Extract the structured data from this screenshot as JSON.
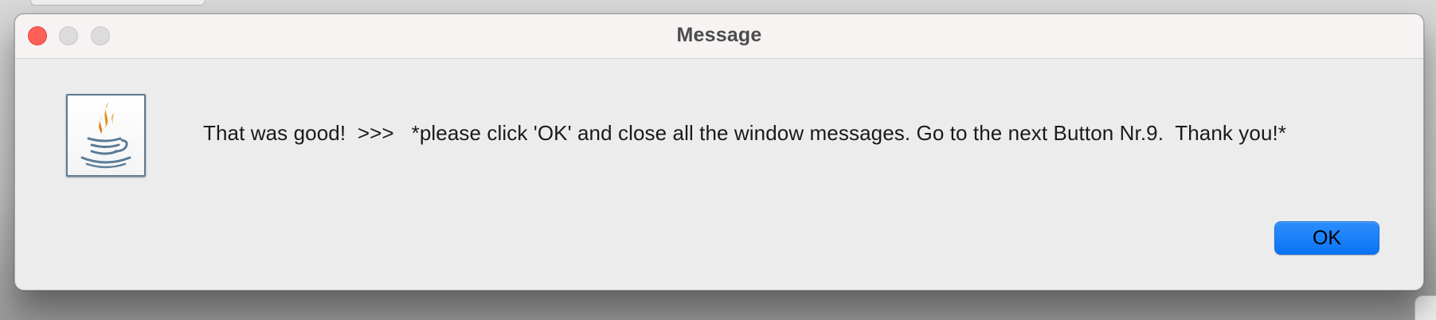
{
  "window": {
    "title": "Message"
  },
  "dialog": {
    "icon": "java-coffee-cup-icon",
    "message": "That was good!  >>>   *please click 'OK' and close all the window messages. Go to the next Button Nr.9.  Thank you!*",
    "ok_label": "OK"
  },
  "colors": {
    "close_button": "#fe5f57",
    "inactive_traffic": "#dcdcdc",
    "accent": "#0a74f5",
    "dialog_background": "#ececec"
  }
}
